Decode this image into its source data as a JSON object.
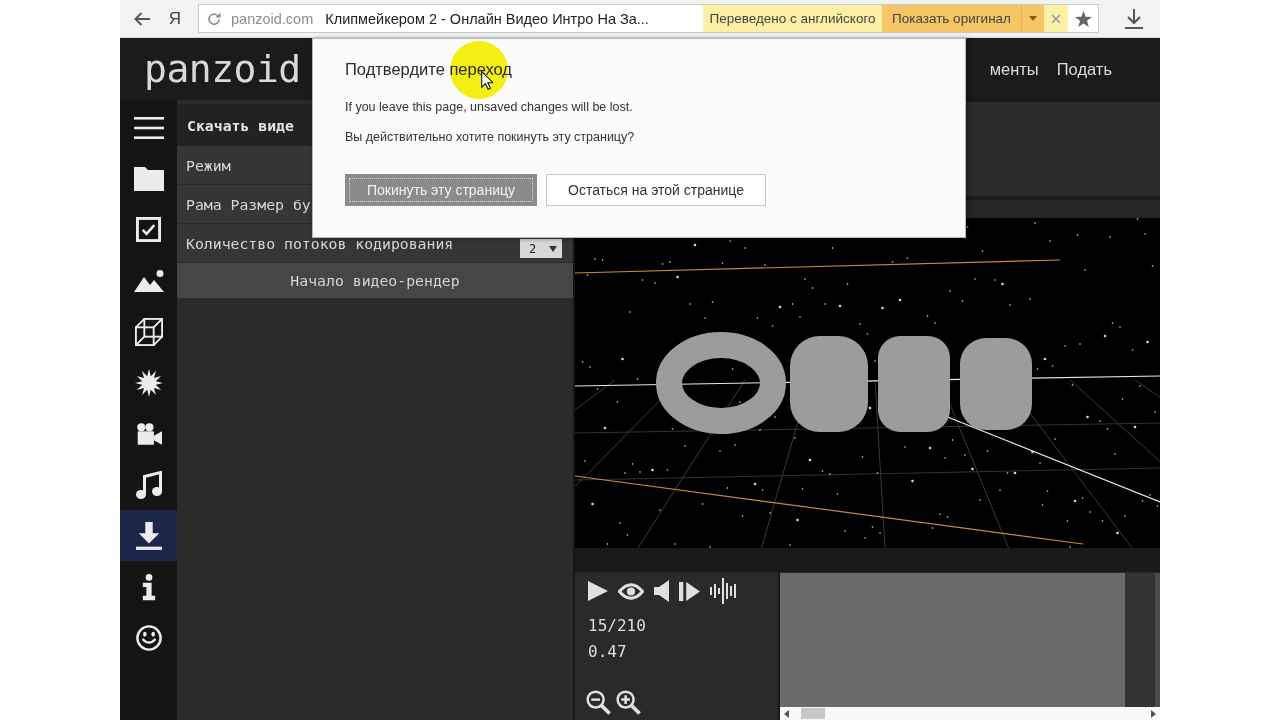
{
  "browser": {
    "nav_button": "Я",
    "url": "panzoid.com",
    "title": "Клипмейкером 2 - Онлайн Видео Интро На За...",
    "translation_status": "Переведено с английского",
    "show_original": "Показать оригинал"
  },
  "header": {
    "logo": "panzoid",
    "nav": [
      {
        "label": "менты"
      },
      {
        "label": "Подать"
      }
    ]
  },
  "sidebar": {
    "items": [
      {
        "kind": "menu",
        "selected": false
      },
      {
        "kind": "folder",
        "selected": false
      },
      {
        "kind": "checkbox",
        "selected": false
      },
      {
        "kind": "image",
        "selected": false
      },
      {
        "kind": "cube",
        "selected": false
      },
      {
        "kind": "burst",
        "selected": false
      },
      {
        "kind": "camera",
        "selected": false
      },
      {
        "kind": "music",
        "selected": false
      },
      {
        "kind": "download",
        "selected": true
      },
      {
        "kind": "info",
        "selected": false
      },
      {
        "kind": "smiley",
        "selected": false
      }
    ]
  },
  "panel": {
    "title": "Скачать виде",
    "rows": [
      {
        "kind": "label",
        "label": "Режим"
      },
      {
        "kind": "label",
        "label": "Рама Размер бу"
      },
      {
        "kind": "select",
        "label": "Количество потоков кодирования",
        "value": "2"
      }
    ],
    "render_button": "Начало видео-рендер"
  },
  "player": {
    "controls": [
      {
        "kind": "play"
      },
      {
        "kind": "eye"
      },
      {
        "kind": "volume"
      },
      {
        "kind": "step"
      },
      {
        "kind": "waveform"
      }
    ],
    "frame": "15/210",
    "time": "0.47",
    "zoom": [
      {
        "kind": "zoom_out"
      },
      {
        "kind": "zoom_in"
      }
    ]
  },
  "dialog": {
    "title": "Подтвердите переход",
    "message": "If you leave this page, unsaved changes will be lost.",
    "question": "Вы действительно хотите покинуть эту страницу?",
    "buttons": [
      {
        "label": "Покинуть эту страницу",
        "focused": true
      },
      {
        "label": "Остаться на этой странице",
        "focused": false
      }
    ]
  }
}
